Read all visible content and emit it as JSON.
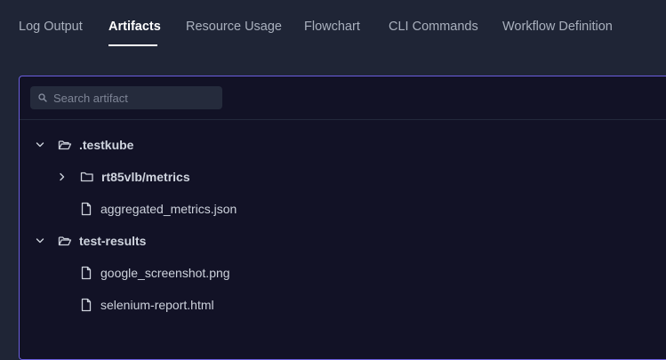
{
  "tabs": [
    {
      "label": "Log Output",
      "active": false
    },
    {
      "label": "Artifacts",
      "active": true
    },
    {
      "label": "Resource Usage",
      "active": false
    },
    {
      "label": "Flowchart",
      "active": false
    },
    {
      "label": "CLI Commands",
      "active": false
    },
    {
      "label": "Workflow Definition",
      "active": false
    }
  ],
  "search": {
    "placeholder": "Search artifact",
    "value": ""
  },
  "tree": [
    {
      "type": "folder",
      "name": ".testkube",
      "expanded": true
    },
    {
      "type": "folder",
      "name": "rt85vlb/metrics",
      "expanded": false
    },
    {
      "type": "file",
      "name": "aggregated_metrics.json"
    },
    {
      "type": "folder",
      "name": "test-results",
      "expanded": true
    },
    {
      "type": "file",
      "name": "google_screenshot.png"
    },
    {
      "type": "file",
      "name": "selenium-report.html"
    }
  ],
  "icons": {
    "expanded": "chevron-down-icon",
    "collapsed": "chevron-right-icon",
    "open_folder": "folder-open-icon",
    "closed_folder": "folder-icon",
    "file": "file-icon",
    "search": "search-icon"
  },
  "colors": {
    "background": "#1f2536",
    "panel": "#121226",
    "panel_border": "#6b5fe0",
    "active_tab": "#ffffff",
    "inactive_tab": "#a9b0bd"
  }
}
